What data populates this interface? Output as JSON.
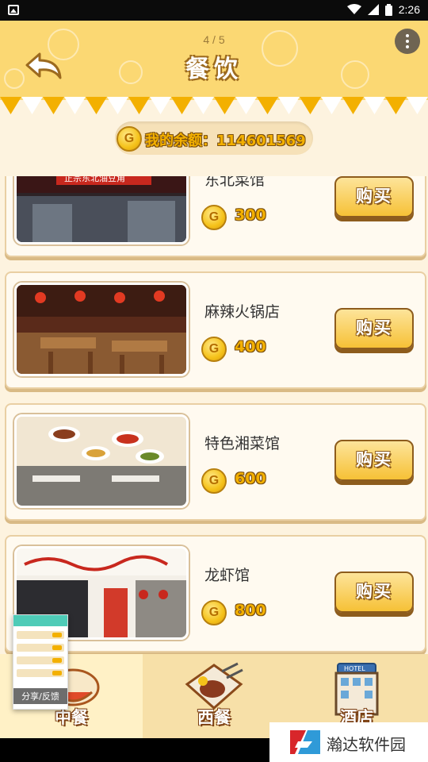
{
  "status_bar": {
    "time": "2:26"
  },
  "header": {
    "pager": "4 / 5",
    "title": "餐饮"
  },
  "balance": {
    "coin_symbol": "G",
    "text": "我的余额：114601569"
  },
  "items": [
    {
      "name": "东北菜馆",
      "price": "300",
      "buy_label": "购买"
    },
    {
      "name": "麻辣火锅店",
      "price": "400",
      "buy_label": "购买"
    },
    {
      "name": "特色湘菜馆",
      "price": "600",
      "buy_label": "购买"
    },
    {
      "name": "龙虾馆",
      "price": "800",
      "buy_label": "购买"
    }
  ],
  "tabs": [
    {
      "label": "中餐",
      "active": true
    },
    {
      "label": "西餐",
      "active": false
    },
    {
      "label": "酒店",
      "active": false
    }
  ],
  "floating_widget": {
    "caption": "分享/反馈"
  },
  "watermark": {
    "text": "瀚达软件园"
  },
  "colors": {
    "header_bg": "#fbd873",
    "coin_gold": "#f3b000",
    "button_gold": "#f6c136",
    "page_bg": "#fdf3df"
  }
}
